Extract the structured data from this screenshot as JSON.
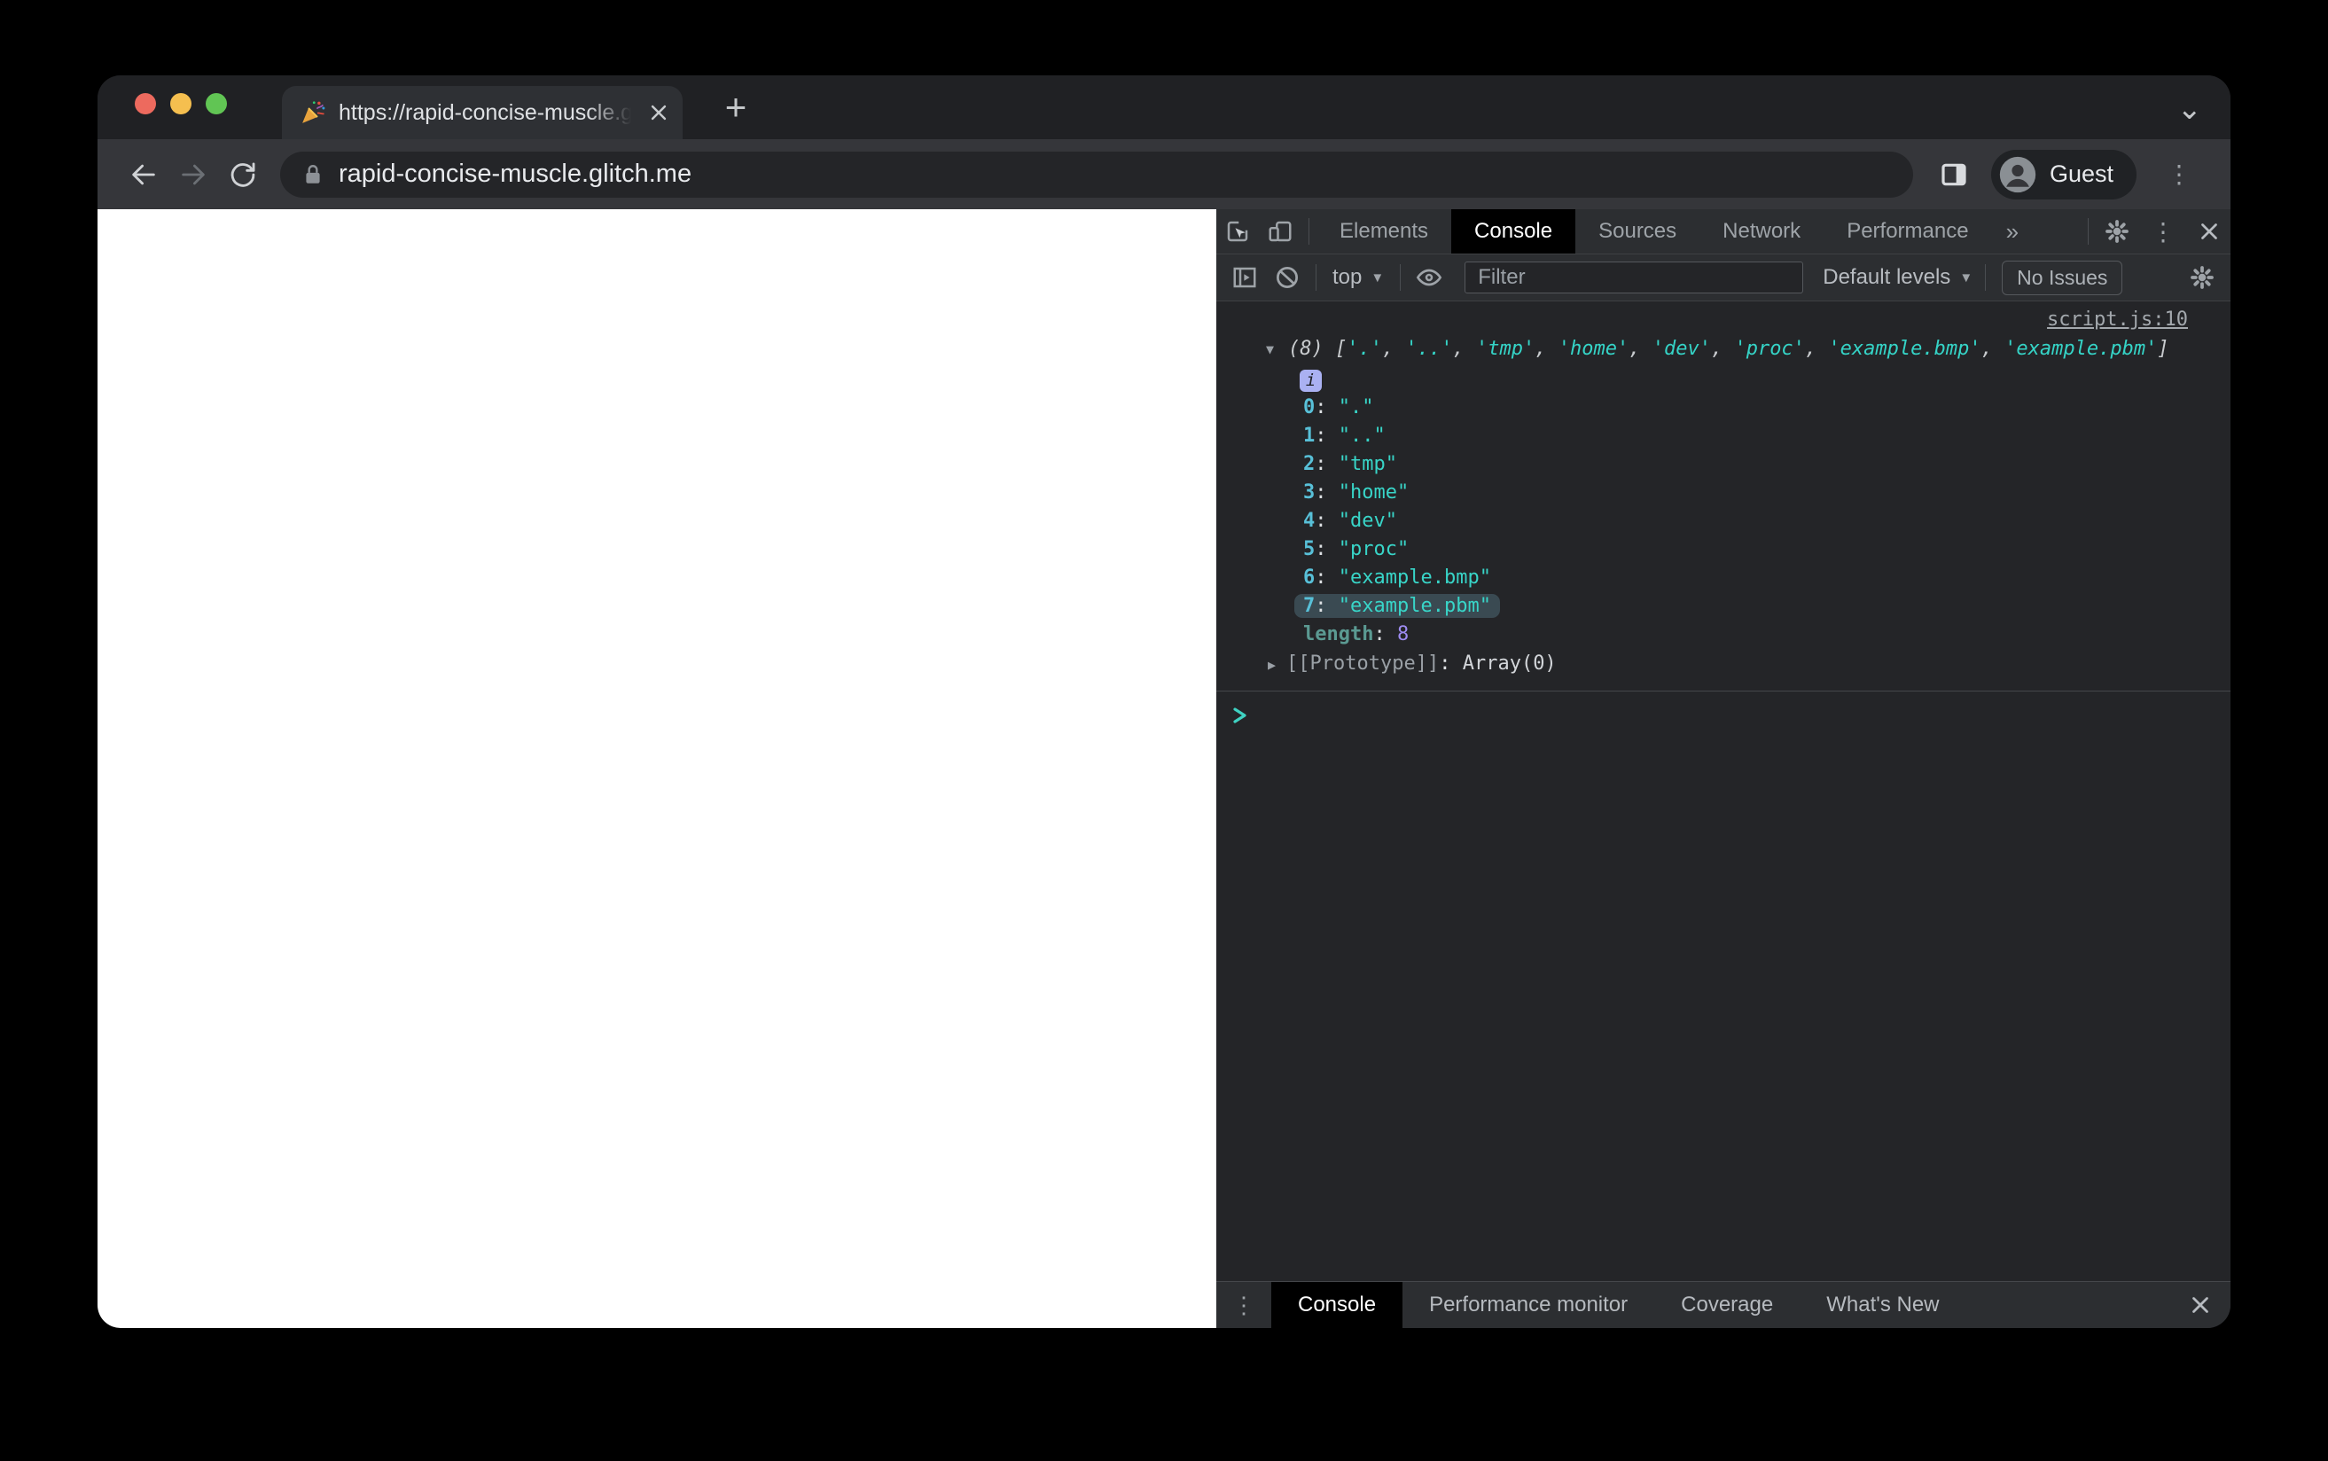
{
  "colors": {
    "traffic_red": "#ed6a5e",
    "traffic_yellow": "#f5bf4f",
    "traffic_green": "#61c554",
    "console_string": "#35d4c7",
    "console_index": "#58c0d8",
    "console_number": "#9e8cf2",
    "info_badge": "#aab1f2",
    "highlight_row": "#3a4a52",
    "active_tab_bg": "#000000"
  },
  "icons": {
    "tab_favicon": "party-popper",
    "nav": [
      "back-arrow",
      "forward-arrow",
      "reload"
    ],
    "urlbar": [
      "lock"
    ],
    "toolbar_right": [
      "side-panel",
      "avatar",
      "kebab-menu"
    ],
    "devtools": [
      "inspect-cursor",
      "device-toolbar",
      "gear",
      "kebab-menu",
      "close"
    ],
    "console_toolbar": [
      "console-sidebar",
      "ban-clear",
      "eye"
    ]
  },
  "glyphs": {
    "new_tab": "+",
    "window_chevron": "⌄",
    "kebab": "⋮",
    "more_tabs": "»",
    "dropdown_arrow": "▼",
    "expanded": "▼",
    "collapsed": "▶",
    "info": "i"
  },
  "browser": {
    "tab_title": "https://rapid-concise-muscle.g",
    "url": "rapid-concise-muscle.glitch.me",
    "profile_label": "Guest"
  },
  "devtools": {
    "main_tabs": [
      {
        "label": "Elements",
        "active": false
      },
      {
        "label": "Console",
        "active": true
      },
      {
        "label": "Sources",
        "active": false
      },
      {
        "label": "Network",
        "active": false
      },
      {
        "label": "Performance",
        "active": false
      }
    ],
    "console_toolbar": {
      "context_label": "top",
      "filter_placeholder": "Filter",
      "levels_label": "Default levels",
      "issues_label": "No Issues"
    },
    "console": {
      "source_link": "script.js:10",
      "preview_segments": [
        {
          "text": "(8) ",
          "cls": "meta"
        },
        {
          "text": "[",
          "cls": "meta"
        },
        {
          "text": "'.'",
          "cls": "str"
        },
        {
          "text": ", ",
          "cls": "meta"
        },
        {
          "text": "'..'",
          "cls": "str"
        },
        {
          "text": ", ",
          "cls": "meta"
        },
        {
          "text": "'tmp'",
          "cls": "str"
        },
        {
          "text": ", ",
          "cls": "meta"
        },
        {
          "text": "'home'",
          "cls": "str"
        },
        {
          "text": ", ",
          "cls": "meta"
        },
        {
          "text": "'dev'",
          "cls": "str"
        },
        {
          "text": ", ",
          "cls": "meta"
        },
        {
          "text": "'proc'",
          "cls": "str"
        },
        {
          "text": ", ",
          "cls": "meta"
        },
        {
          "text": "'example.bmp'",
          "cls": "str"
        },
        {
          "text": ", ",
          "cls": "meta"
        },
        {
          "text": "'example.pbm'",
          "cls": "str"
        },
        {
          "text": "]",
          "cls": "meta"
        }
      ],
      "entries": [
        {
          "index": "0",
          "value": "\".\"",
          "highlighted": false
        },
        {
          "index": "1",
          "value": "\"..\"",
          "highlighted": false
        },
        {
          "index": "2",
          "value": "\"tmp\"",
          "highlighted": false
        },
        {
          "index": "3",
          "value": "\"home\"",
          "highlighted": false
        },
        {
          "index": "4",
          "value": "\"dev\"",
          "highlighted": false
        },
        {
          "index": "5",
          "value": "\"proc\"",
          "highlighted": false
        },
        {
          "index": "6",
          "value": "\"example.bmp\"",
          "highlighted": false
        },
        {
          "index": "7",
          "value": "\"example.pbm\"",
          "highlighted": true
        }
      ],
      "length_label": "length",
      "length_value": "8",
      "prototype_label": "[[Prototype]]",
      "prototype_value": "Array(0)"
    },
    "drawer_tabs": [
      {
        "label": "Console",
        "active": true
      },
      {
        "label": "Performance monitor",
        "active": false
      },
      {
        "label": "Coverage",
        "active": false
      },
      {
        "label": "What's New",
        "active": false
      }
    ]
  }
}
